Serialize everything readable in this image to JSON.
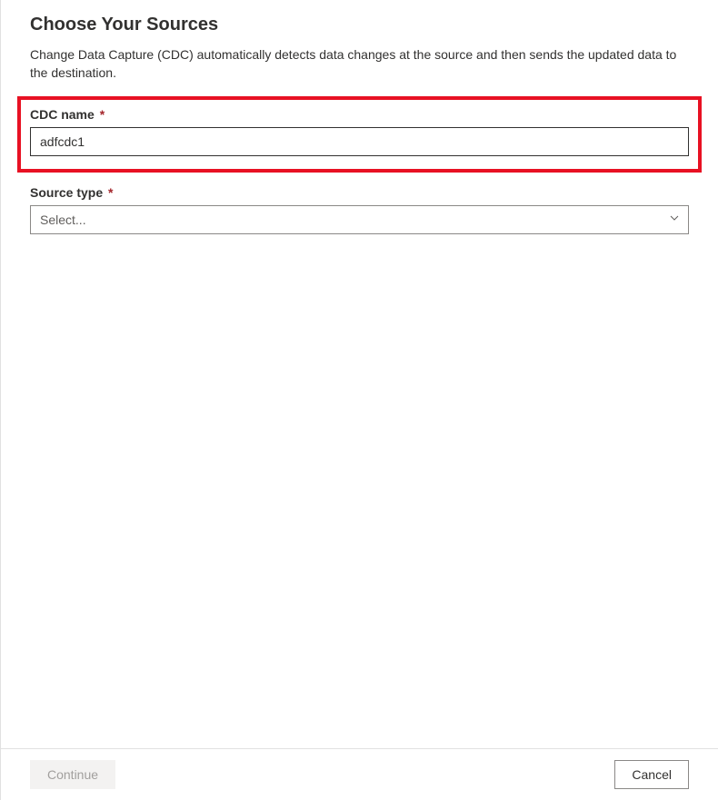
{
  "page": {
    "title": "Choose Your Sources",
    "description": "Change Data Capture (CDC) automatically detects data changes at the source and then sends the updated data to the destination."
  },
  "form": {
    "cdc_name": {
      "label": "CDC name",
      "required": "*",
      "value": "adfcdc1"
    },
    "source_type": {
      "label": "Source type",
      "required": "*",
      "placeholder": "Select..."
    }
  },
  "footer": {
    "continue_label": "Continue",
    "cancel_label": "Cancel"
  }
}
